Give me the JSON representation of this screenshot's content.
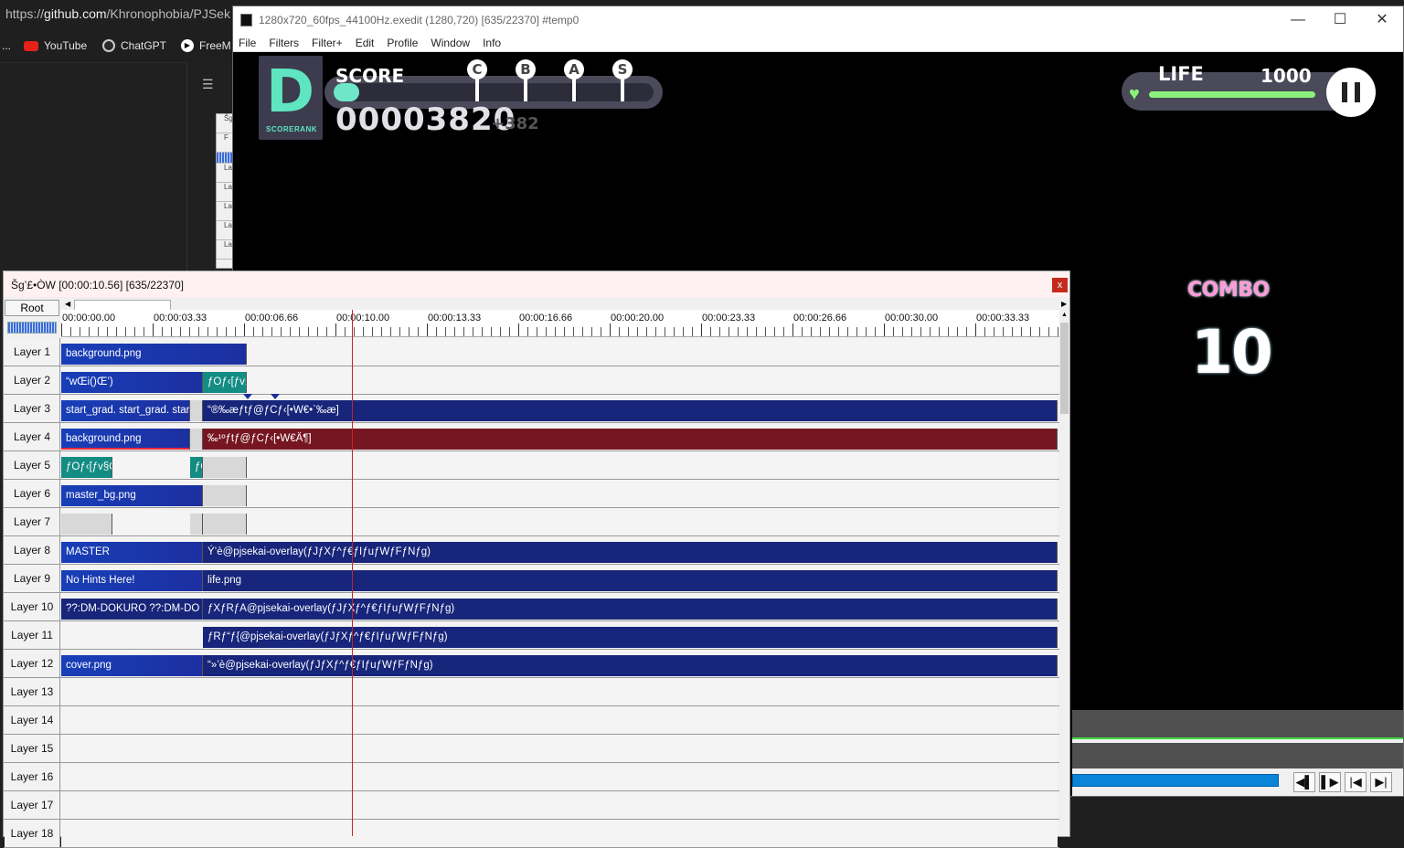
{
  "browser": {
    "url_prefix": "https://",
    "url_host": "github.com",
    "url_path": "/Khronophobia/PJSek",
    "bookmarks_overflow": "...",
    "bookmarks": [
      {
        "label": "YouTube",
        "icon": "youtube-icon"
      },
      {
        "label": "ChatGPT",
        "icon": "chatgpt-icon"
      },
      {
        "label": "FreeM",
        "icon": "play-icon"
      }
    ],
    "mini_list": [
      "Šg",
      "F",
      "",
      "La",
      "La",
      "La",
      "La",
      "La",
      "La"
    ]
  },
  "preview": {
    "title": "1280x720_60fps_44100Hz.exedit (1280,720)  [635/22370]  #temp0",
    "controls": {
      "minimize": "—",
      "maximize": "☐",
      "close": "✕"
    },
    "menu": [
      "File",
      "Filters",
      "Filter+",
      "Edit",
      "Profile",
      "Window",
      "Info"
    ],
    "game": {
      "rank_letter": "D",
      "rank_caption": "SCORERANK",
      "score_label": "SCORE",
      "score_value": "00003820",
      "score_delta": "+382",
      "score_progress": 0.08,
      "rank_markers": [
        "C",
        "B",
        "A",
        "S"
      ],
      "life_label": "LIFE",
      "life_value": "1000",
      "life_fraction": 1.0,
      "combo_label": "COMBO",
      "combo_value": "10"
    },
    "nav_buttons": [
      "◀▌",
      "▌▶",
      "|◀",
      "▶|"
    ]
  },
  "timeline": {
    "title": "Šg’£•ÒW [00:00:10.56] [635/22370]",
    "close_label": "x",
    "root_label": "Root",
    "ruler": [
      "00:00:00.00",
      "00:00:03.33",
      "00:00:06.66",
      "00:00:10.00",
      "00:00:13.33",
      "00:00:16.66",
      "00:00:20.00",
      "00:00:23.33",
      "00:00:26.66",
      "00:00:30.00",
      "00:00:33.33"
    ],
    "layers": [
      {
        "label": "Layer 1",
        "objects": [
          {
            "text": "background.png",
            "style": "blue",
            "a": 0,
            "b": 203
          }
        ]
      },
      {
        "label": "Layer 2",
        "objects": [
          {
            "text": "“wŒi()Œ’)",
            "style": "blue",
            "a": 0,
            "b": 155
          },
          {
            "text": "ƒOƒ‹[ƒv§",
            "style": "teal",
            "a": 155,
            "b": 203
          }
        ]
      },
      {
        "label": "Layer 3",
        "objects": [
          {
            "text": "start_grad. start_grad. star",
            "style": "blue",
            "a": 0,
            "b": 141
          },
          {
            "text": "",
            "style": "gray",
            "a": 141,
            "b": 155
          },
          {
            "text": "“®‰æƒtƒ@ƒCƒ‹[•W€•`‰æ]",
            "style": "navy",
            "a": 155,
            "b": 1090
          }
        ]
      },
      {
        "label": "Layer 4",
        "objects": [
          {
            "text": "background.png",
            "style": "blue red-mark",
            "a": 0,
            "b": 141
          },
          {
            "text": "",
            "style": "gray",
            "a": 141,
            "b": 155
          },
          {
            "text": "‰¹ºƒtƒ@ƒCƒ‹[•W€Ä¶]",
            "style": "red",
            "a": 155,
            "b": 1090
          }
        ]
      },
      {
        "label": "Layer 5",
        "objects": [
          {
            "text": "ƒOƒ‹[ƒv§Œ",
            "style": "teal",
            "a": 0,
            "b": 56
          },
          {
            "text": "ƒO",
            "style": "teal",
            "a": 141,
            "b": 155
          },
          {
            "text": "",
            "style": "gray",
            "a": 155,
            "b": 203
          }
        ]
      },
      {
        "label": "Layer 6",
        "objects": [
          {
            "text": "master_bg.png",
            "style": "blue",
            "a": 0,
            "b": 155
          },
          {
            "text": "",
            "style": "gray",
            "a": 155,
            "b": 203
          }
        ]
      },
      {
        "label": "Layer 7",
        "objects": [
          {
            "text": "",
            "style": "gray",
            "a": 0,
            "b": 56
          },
          {
            "text": "",
            "style": "gray",
            "a": 141,
            "b": 155
          },
          {
            "text": "",
            "style": "gray",
            "a": 155,
            "b": 203
          }
        ]
      },
      {
        "label": "Layer 8",
        "objects": [
          {
            "text": "MASTER",
            "style": "blue",
            "a": 0,
            "b": 155
          },
          {
            "text": "Ý’è@pjsekai-overlay(ƒJƒXƒ^ƒ€ƒIƒuƒWƒFƒNƒg)",
            "style": "navy",
            "a": 155,
            "b": 1090
          }
        ]
      },
      {
        "label": "Layer 9",
        "objects": [
          {
            "text": "No Hints Here!",
            "style": "blue",
            "a": 0,
            "b": 155
          },
          {
            "text": "life.png",
            "style": "navy",
            "a": 155,
            "b": 1090
          }
        ]
      },
      {
        "label": "Layer 10",
        "objects": [
          {
            "text": "??:DM-DOKURO    ??:DM-DO",
            "style": "navy",
            "a": 0,
            "b": 155
          },
          {
            "text": "ƒXƒRƒA@pjsekai-overlay(ƒJƒXƒ^ƒ€ƒIƒuƒWƒFƒNƒg)",
            "style": "navy",
            "a": 155,
            "b": 1090
          }
        ]
      },
      {
        "label": "Layer 11",
        "objects": [
          {
            "text": "ƒRƒ“ƒ{@pjsekai-overlay(ƒJƒXƒ^ƒ€ƒIƒuƒWƒFƒNƒg)",
            "style": "navy",
            "a": 155,
            "b": 1090
          }
        ]
      },
      {
        "label": "Layer 12",
        "objects": [
          {
            "text": "cover.png",
            "style": "blue",
            "a": 0,
            "b": 155
          },
          {
            "text": "“»’è@pjsekai-overlay(ƒJƒXƒ^ƒ€ƒIƒuƒWƒFƒNƒg)",
            "style": "navy",
            "a": 155,
            "b": 1090
          }
        ]
      },
      {
        "label": "Layer 13",
        "objects": []
      },
      {
        "label": "Layer 14",
        "objects": []
      },
      {
        "label": "Layer 15",
        "objects": []
      },
      {
        "label": "Layer 16",
        "objects": []
      },
      {
        "label": "Layer 17",
        "objects": []
      },
      {
        "label": "Layer 18",
        "objects": []
      }
    ]
  }
}
